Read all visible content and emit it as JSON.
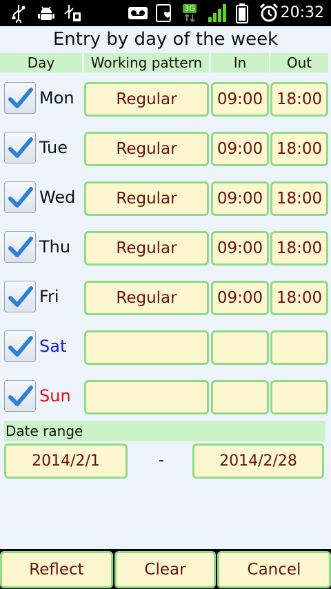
{
  "status_bar": {
    "time": "20:32",
    "network_label": "3G",
    "icons": [
      "usb-icon",
      "android-debug-icon",
      "usb-storage-icon",
      "voicemail-icon",
      "notification-heart-icon",
      "signal-icon",
      "battery-icon",
      "alarm-icon"
    ]
  },
  "title": "Entry by day of the week",
  "headers": {
    "day": "Day",
    "pattern": "Working pattern",
    "in": "In",
    "out": "Out"
  },
  "days": [
    {
      "label": "Mon",
      "checked": true,
      "pattern": "Regular",
      "in": "09:00",
      "out": "18:00"
    },
    {
      "label": "Tue",
      "checked": true,
      "pattern": "Regular",
      "in": "09:00",
      "out": "18:00"
    },
    {
      "label": "Wed",
      "checked": true,
      "pattern": "Regular",
      "in": "09:00",
      "out": "18:00"
    },
    {
      "label": "Thu",
      "checked": true,
      "pattern": "Regular",
      "in": "09:00",
      "out": "18:00"
    },
    {
      "label": "Fri",
      "checked": true,
      "pattern": "Regular",
      "in": "09:00",
      "out": "18:00"
    },
    {
      "label": "Sat",
      "checked": true,
      "pattern": "",
      "in": "",
      "out": ""
    },
    {
      "label": "Sun",
      "checked": true,
      "pattern": "",
      "in": "",
      "out": ""
    }
  ],
  "date_range": {
    "label": "Date range",
    "start": "2014/2/1",
    "separator": "-",
    "end": "2014/2/28"
  },
  "buttons": {
    "reflect": "Reflect",
    "clear": "Clear",
    "cancel": "Cancel"
  },
  "colors": {
    "header_bg": "#ccf2c8",
    "cell_bg": "#fdf7cf",
    "cell_border": "#8fdb86",
    "cell_text": "#6a0f0f",
    "saturday": "#1a1adf",
    "sunday": "#e01010",
    "check": "#2e7fd6"
  }
}
